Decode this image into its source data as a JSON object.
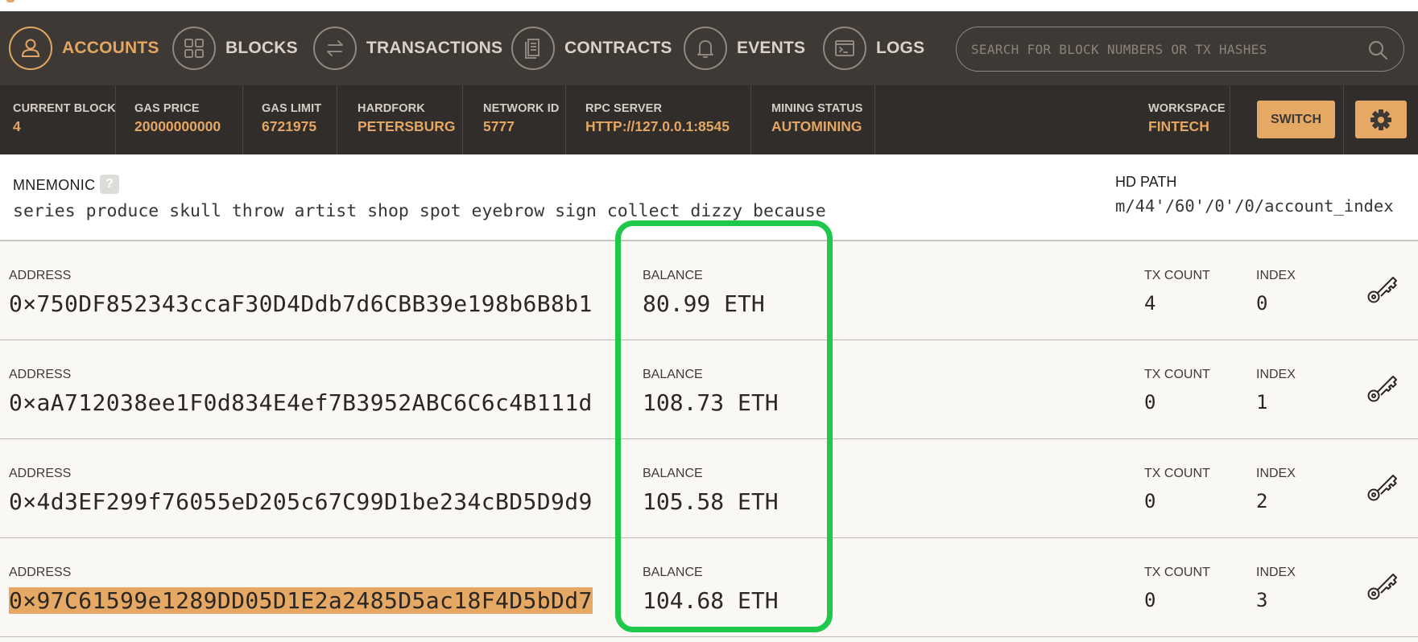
{
  "nav": {
    "items": [
      {
        "label": "ACCOUNTS",
        "icon": "person-icon",
        "active": true
      },
      {
        "label": "BLOCKS",
        "icon": "grid-icon",
        "active": false
      },
      {
        "label": "TRANSACTIONS",
        "icon": "arrows-swap-icon",
        "active": false
      },
      {
        "label": "CONTRACTS",
        "icon": "document-icon",
        "active": false
      },
      {
        "label": "EVENTS",
        "icon": "bell-icon",
        "active": false
      },
      {
        "label": "LOGS",
        "icon": "terminal-icon",
        "active": false
      }
    ],
    "search_placeholder": "SEARCH FOR BLOCK NUMBERS OR TX HASHES"
  },
  "status": {
    "current_block": {
      "label": "CURRENT BLOCK",
      "value": "4"
    },
    "gas_price": {
      "label": "GAS PRICE",
      "value": "20000000000"
    },
    "gas_limit": {
      "label": "GAS LIMIT",
      "value": "6721975"
    },
    "hardfork": {
      "label": "HARDFORK",
      "value": "PETERSBURG"
    },
    "network_id": {
      "label": "NETWORK ID",
      "value": "5777"
    },
    "rpc_server": {
      "label": "RPC SERVER",
      "value": "HTTP://127.0.0.1:8545"
    },
    "mining_status": {
      "label": "MINING STATUS",
      "value": "AUTOMINING"
    },
    "workspace": {
      "label": "WORKSPACE",
      "value": "FINTECH"
    },
    "switch_label": "SWITCH"
  },
  "mnemonic": {
    "label": "MNEMONIC",
    "help": "?",
    "words": "series produce skull throw artist shop spot eyebrow sign collect dizzy because",
    "hd_path_label": "HD PATH",
    "hd_path": "m/44'/60'/0'/0/account_index"
  },
  "labels": {
    "address": "ADDRESS",
    "balance": "BALANCE",
    "tx_count": "TX COUNT",
    "index": "INDEX"
  },
  "accounts": [
    {
      "address": "0×750DF852343ccaF30D4Ddb7d6CBB39e198b6B8b1",
      "balance": "80.99 ETH",
      "tx_count": "4",
      "index": "0",
      "selected": false
    },
    {
      "address": "0×aA712038ee1F0d834E4ef7B3952ABC6C6c4B111d",
      "balance": "108.73 ETH",
      "tx_count": "0",
      "index": "1",
      "selected": false
    },
    {
      "address": "0×4d3EF299f76055eD205c67C99D1be234cBD5D9d9",
      "balance": "105.58 ETH",
      "tx_count": "0",
      "index": "2",
      "selected": false
    },
    {
      "address": "0×97C61599e1289DD05D1E2a2485D5ac18F4D5bDd7",
      "balance": "104.68 ETH",
      "tx_count": "0",
      "index": "3",
      "selected": true
    }
  ],
  "colors": {
    "accent": "#e4a663",
    "nav_bg": "#3e3935",
    "status_bg": "#312d2a",
    "highlight": "#1ec84b"
  }
}
